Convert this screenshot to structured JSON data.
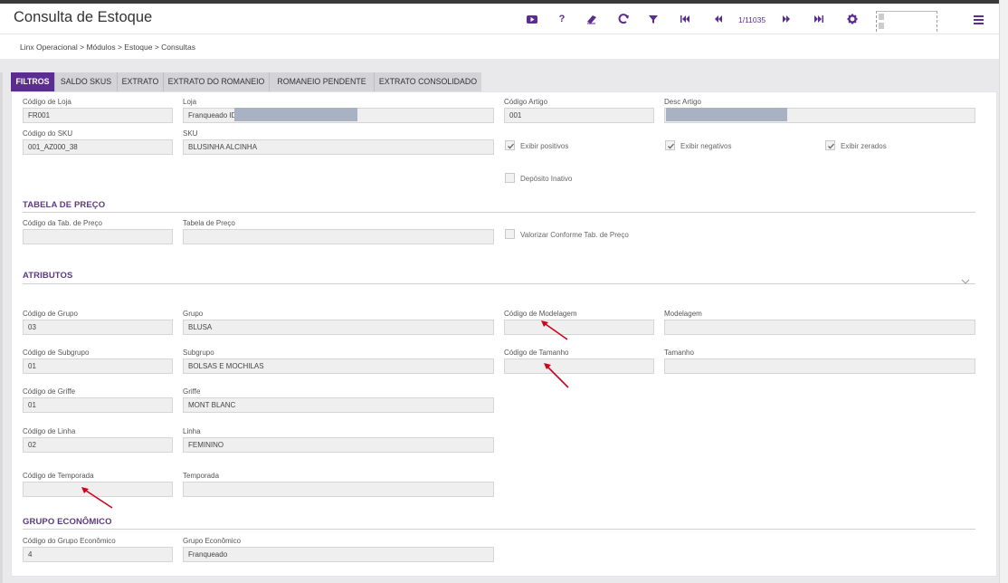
{
  "header": {
    "title": "Consulta de Estoque",
    "page_count": "1/11035",
    "accent_color": "#5c2d91",
    "tools": [
      "youtube-icon",
      "help-icon",
      "eraser-icon",
      "refresh-icon",
      "filter-icon",
      "first-page-icon",
      "previous-page-icon",
      "next-page-icon",
      "last-page-icon",
      "gear-icon",
      "menu-icon"
    ]
  },
  "breadcrumb": "Linx Operacional  >  Módulos  >  Estoque  >  Consultas",
  "tabs": [
    "FILTROS",
    "SALDO SKUS",
    "EXTRATO",
    "EXTRATO DO ROMANEIO",
    "ROMANEIO PENDENTE",
    "EXTRATO CONSOLIDADO"
  ],
  "filtros": {
    "codigo_loja": {
      "label": "Código de Loja",
      "value": "FR001"
    },
    "loja": {
      "label": "Loja",
      "value": "Franqueado ID"
    },
    "codigo_artigo": {
      "label": "Código Artigo",
      "value": "001"
    },
    "desc_artigo": {
      "label": "Desc Artigo",
      "value": ""
    },
    "codigo_sku": {
      "label": "Código do SKU",
      "value": "001_AZ000_38"
    },
    "sku": {
      "label": "SKU",
      "value": "BLUSINHA ALCINHA"
    },
    "exibir_positivos": {
      "label": "Exibir positivos",
      "checked": true
    },
    "exibir_negativos": {
      "label": "Exibir negativos",
      "checked": true
    },
    "exibir_zerados": {
      "label": "Exibir zerados",
      "checked": true
    },
    "deposito_inativo": {
      "label": "Depósito Inativo",
      "checked": false
    }
  },
  "tabela_preco": {
    "title": "TABELA DE PREÇO",
    "codigo": {
      "label": "Código da Tab. de Preço",
      "value": ""
    },
    "tabela": {
      "label": "Tabela de Preço",
      "value": ""
    },
    "valorizar": {
      "label": "Valorizar Conforme Tab. de Preço",
      "checked": false
    }
  },
  "atributos": {
    "title": "ATRIBUTOS",
    "codigo_grupo": {
      "label": "Código de Grupo",
      "value": "03"
    },
    "grupo": {
      "label": "Grupo",
      "value": "BLUSA"
    },
    "codigo_modelagem": {
      "label": "Código de Modelagem",
      "value": ""
    },
    "modelagem": {
      "label": "Modelagem",
      "value": ""
    },
    "codigo_subgrupo": {
      "label": "Código de Subgrupo",
      "value": "01"
    },
    "subgrupo": {
      "label": "Subgrupo",
      "value": "BOLSAS E MOCHILAS"
    },
    "codigo_tamanho": {
      "label": "Código de Tamanho",
      "value": ""
    },
    "tamanho": {
      "label": "Tamanho",
      "value": ""
    },
    "codigo_griffe": {
      "label": "Código de Griffe",
      "value": "01"
    },
    "griffe": {
      "label": "Griffe",
      "value": "MONT BLANC"
    },
    "codigo_linha": {
      "label": "Código de Linha",
      "value": "02"
    },
    "linha": {
      "label": "Linha",
      "value": "FEMININO"
    },
    "codigo_temporada": {
      "label": "Código de Temporada",
      "value": ""
    },
    "temporada": {
      "label": "Temporada",
      "value": ""
    }
  },
  "grupo_economico": {
    "title": "GRUPO ECONÔMICO",
    "codigo": {
      "label": "Código do Grupo Econômico",
      "value": "4"
    },
    "grupo": {
      "label": "Grupo Econômico",
      "value": "Franqueado"
    }
  },
  "annotation_color": "#d0021b"
}
